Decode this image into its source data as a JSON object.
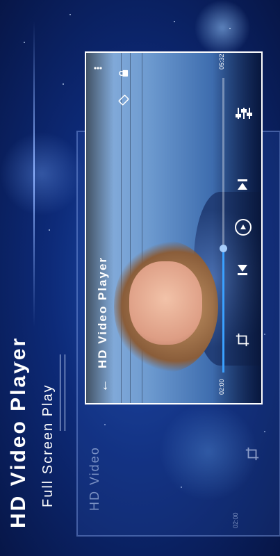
{
  "promo": {
    "title": "HD Video Player",
    "subtitle": "Full Screen Play"
  },
  "ghost_player": {
    "title": "HD Video",
    "time": "02:00"
  },
  "player": {
    "title": "HD Video Player",
    "current_time": "02:00",
    "total_time": "05:32",
    "progress": 0.42
  },
  "icons": [
    "back-arrow-icon",
    "more-vert-icon",
    "lock-icon",
    "rotate-screen-icon",
    "equalizer-icon",
    "crop-icon",
    "previous-icon",
    "play-icon",
    "next-icon"
  ],
  "colors": {
    "accent": "#3aa0ff",
    "background": "#0d2a78"
  }
}
